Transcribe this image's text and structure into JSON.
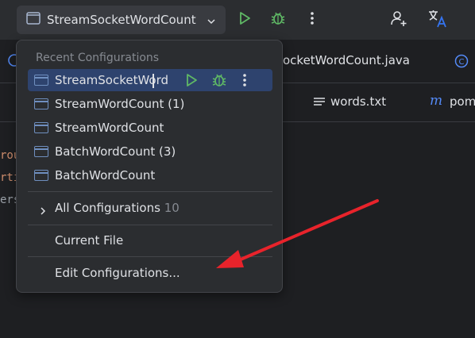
{
  "toolbar": {
    "run_config_label": "StreamSocketWordCount",
    "icons": [
      "run-config-icon",
      "chevron-down-icon",
      "run-icon",
      "debug-icon",
      "more-vertical-icon",
      "add-user-icon",
      "translate-icon"
    ],
    "colors": {
      "run": "#5fb865",
      "debug": "#5fb865",
      "accent": "#3574f0"
    }
  },
  "tabs": {
    "row1": [
      {
        "label": "ocketWordCount.java",
        "icon": "java-class-icon"
      },
      {
        "label": "",
        "icon": "java-class-icon"
      }
    ],
    "row2": [
      {
        "label": "words.txt",
        "icon": "text-file-icon"
      },
      {
        "label": "pom",
        "icon": "maven-icon"
      }
    ]
  },
  "editor": {
    "code_fragments": [
      "rou",
      "rti",
      "ers"
    ]
  },
  "popup": {
    "header": "Recent Configurations",
    "recent": [
      {
        "label": "StreamSocketWord",
        "selected": true
      },
      {
        "label": "StreamWordCount (1)",
        "selected": false
      },
      {
        "label": "StreamWordCount",
        "selected": false
      },
      {
        "label": "BatchWordCount (3)",
        "selected": false
      },
      {
        "label": "BatchWordCount",
        "selected": false
      }
    ],
    "all_configurations": {
      "label": "All Configurations",
      "count": "10"
    },
    "current_file": "Current File",
    "edit_configurations": "Edit Configurations..."
  },
  "annotation": {
    "color": "#e8232b"
  }
}
